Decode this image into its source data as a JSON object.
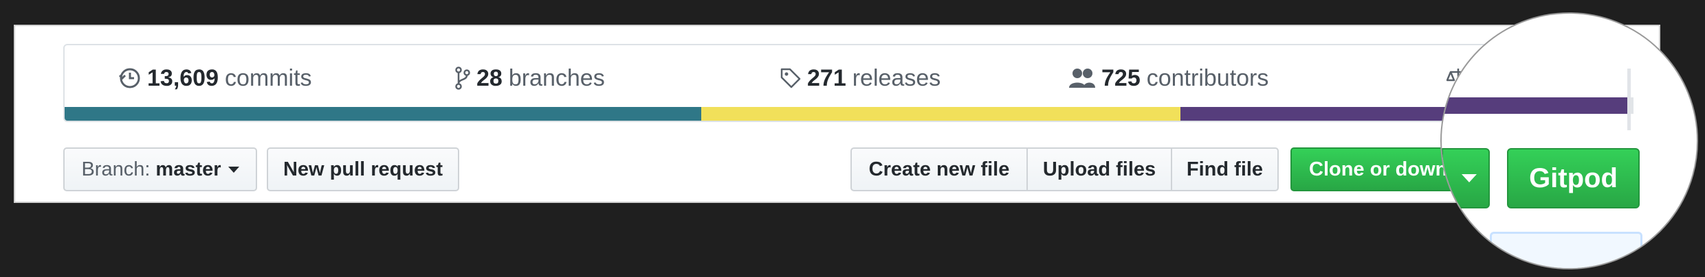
{
  "summary": {
    "commits": {
      "count": "13,609",
      "label": "commits",
      "icon": "history-icon"
    },
    "branches": {
      "count": "28",
      "label": "branches",
      "icon": "branch-icon"
    },
    "releases": {
      "count": "271",
      "label": "releases",
      "icon": "tag-icon"
    },
    "contributors": {
      "count": "725",
      "label": "contributors",
      "icon": "people-icon"
    },
    "license": {
      "icon": "law-icon"
    }
  },
  "language_bar": {
    "segments": [
      {
        "color": "#2f7787",
        "fraction": 0.405
      },
      {
        "color": "#f1e05a",
        "fraction": 0.305
      },
      {
        "color": "#563d7c",
        "fraction": 0.29
      }
    ]
  },
  "toolbar": {
    "branch_prefix": "Branch:",
    "branch_name": "master",
    "new_pull_request": "New pull request",
    "create_new_file": "Create new file",
    "upload_files": "Upload files",
    "find_file": "Find file",
    "clone_or_download": "Clone or down",
    "gitpod": "Gitpod"
  },
  "colors": {
    "accent_green": "#28a745",
    "background": "#1f1f1f"
  }
}
